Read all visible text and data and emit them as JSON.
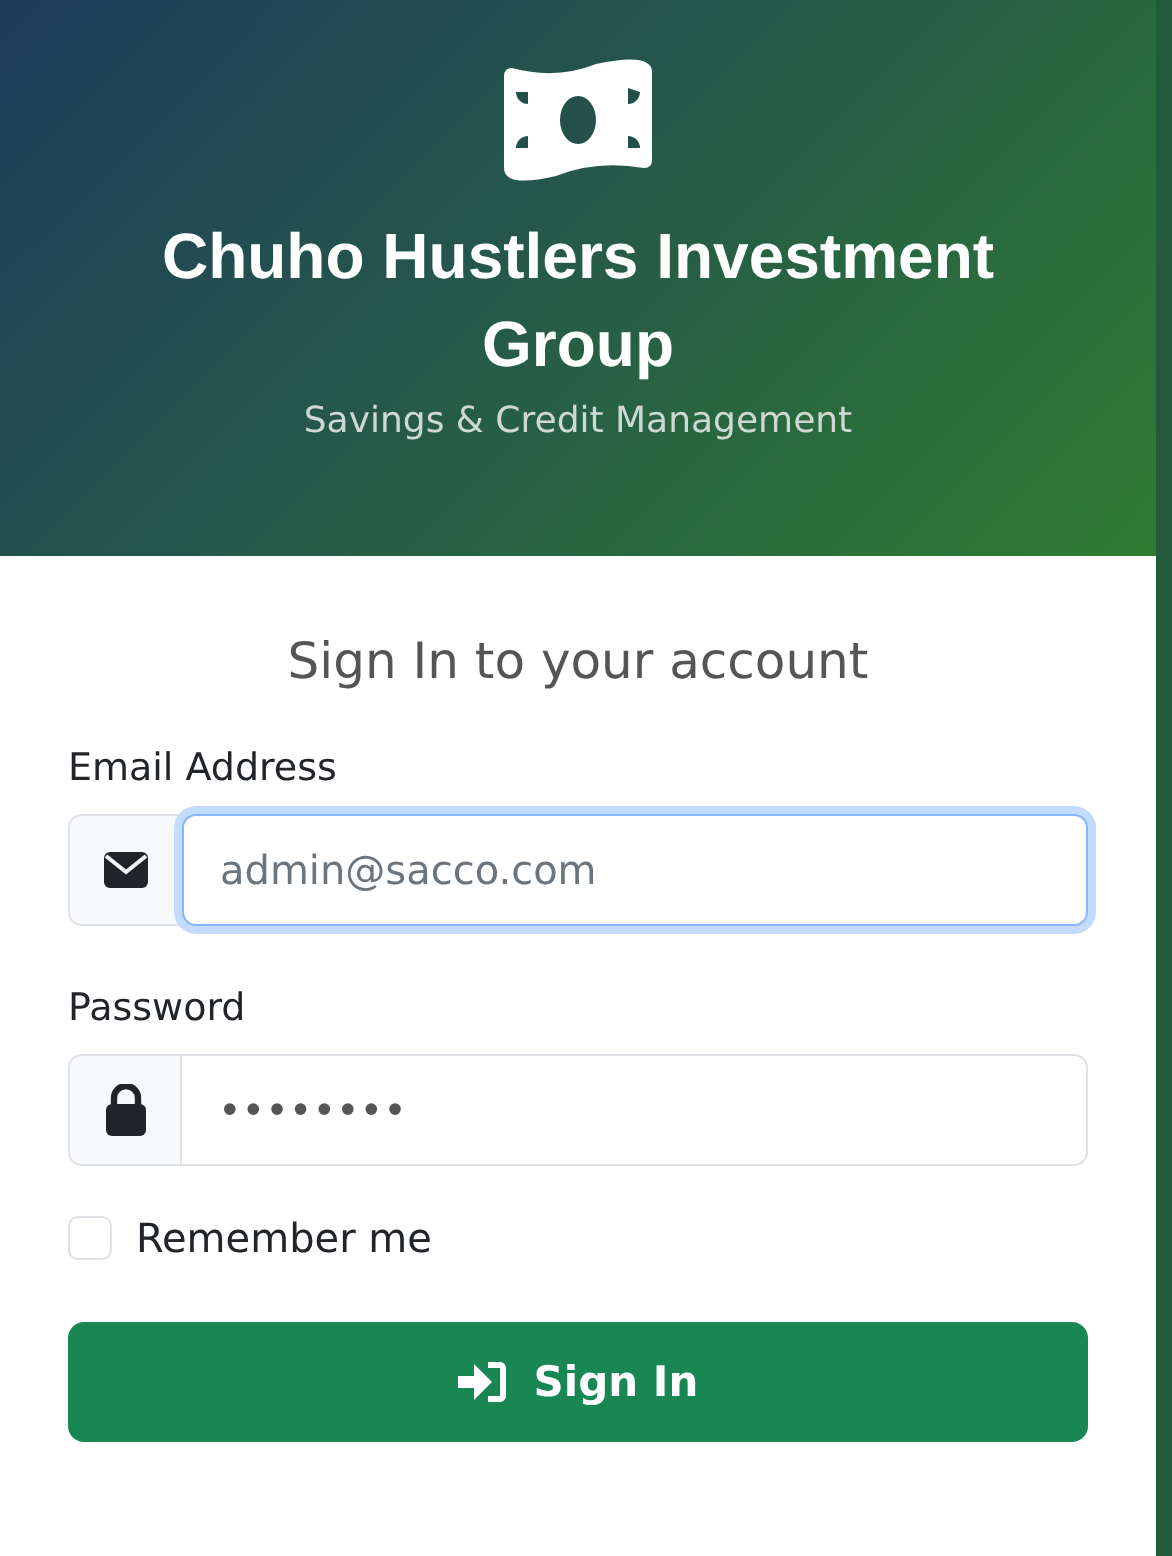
{
  "header": {
    "title": "Chuho Hustlers Investment Group",
    "subtitle": "Savings & Credit Management"
  },
  "form": {
    "heading": "Sign In to your account",
    "fields": [
      {
        "kind": "email",
        "label": "Email Address",
        "placeholder": "admin@sacco.com",
        "focused": true
      },
      {
        "kind": "password",
        "label": "Password",
        "value": "••••••••",
        "focused": false
      }
    ],
    "remember": {
      "label": "Remember me",
      "checked": false
    },
    "submit": {
      "label": "Sign In"
    }
  }
}
